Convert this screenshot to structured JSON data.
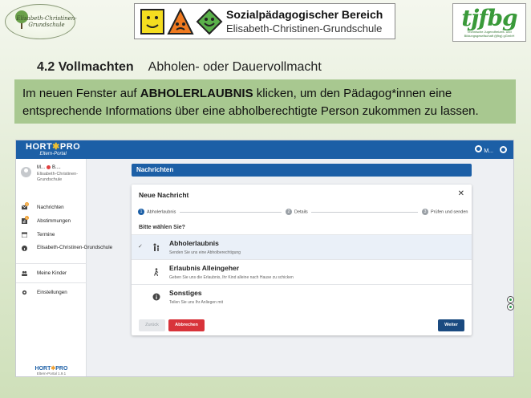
{
  "header": {
    "left_logo_text": "Elisabeth-Christinen-Grundschule",
    "center_logo": {
      "title": "Sozialpädagogischer Bereich",
      "subtitle": "Elisabeth-Christinen-Grundschule"
    },
    "right_logo": {
      "big": "tjfbg",
      "small": "Technische Jugendfreizeit- und Bildungsgesellschaft (tjfbg) gGmbH"
    }
  },
  "heading": {
    "number": "4.2 Vollmachten",
    "subtitle": "Abholen- oder Dauervollmacht"
  },
  "instruction": {
    "before": "Im neuen Fenster auf ",
    "bold": "ABHOLERLAUBNIS",
    "after": " klicken, um den Pädagog*innen eine entsprechende Informations über eine abholberechtigte Person zukommen zu lassen."
  },
  "app": {
    "brand": {
      "title": "HORT",
      "star": "✱",
      "title2": "PRO",
      "subtitle": "Eltern-Portal"
    },
    "top_user": "M...",
    "sidebar": {
      "user_name": "M...",
      "user_name2": "B....",
      "user_school": "Elisabeth-Christinen-Grundschule",
      "items": [
        {
          "label": "Nachrichten",
          "badge": "2"
        },
        {
          "label": "Abstimmungen",
          "badge": "1"
        },
        {
          "label": "Termine"
        },
        {
          "label": "Elisabeth-Christinen-Grundschule"
        },
        {
          "label": "Meine Kinder"
        },
        {
          "label": "Einstellungen"
        }
      ],
      "footer_title": "HORT",
      "footer_title2": "PRO",
      "footer_version": "Eltern-Portal 1.9.1"
    },
    "page_title": "Nachrichten",
    "dialog": {
      "title": "Neue Nachricht",
      "close": "✕",
      "steps": [
        {
          "num": "1",
          "label": "Abholerlaubnis"
        },
        {
          "num": "2",
          "label": "Details"
        },
        {
          "num": "3",
          "label": "Prüfen und senden"
        }
      ],
      "prompt": "Bitte wählen Sie?",
      "options": [
        {
          "title": "Abholerlaubnis",
          "desc": "Senden Sie uns eine Abholberechtigung",
          "selected": true
        },
        {
          "title": "Erlaubnis Alleingeher",
          "desc": "Geben Sie uns die Erlaubnis, Ihr Kind alleine nach Hause zu schicken"
        },
        {
          "title": "Sonstiges",
          "desc": "Teilen Sie uns Ihr Anliegen mit"
        }
      ],
      "buttons": {
        "back": "Zurück",
        "cancel": "Abbrechen",
        "next": "Weiter"
      }
    }
  },
  "colors": {
    "primary": "#1c5fa6",
    "cancel": "#d8333a",
    "instruction_bg": "#a8c890"
  }
}
